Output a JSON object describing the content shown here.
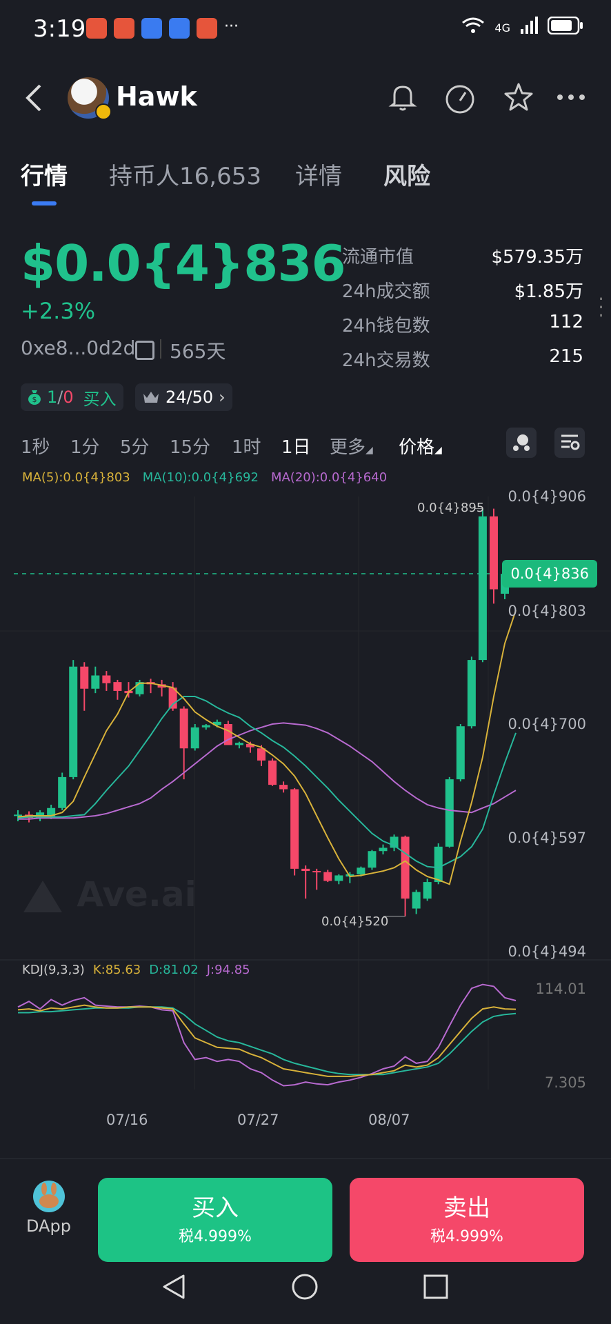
{
  "status_bar": {
    "time": "3:19",
    "more": "···",
    "network": "4G"
  },
  "header": {
    "title": "Hawk"
  },
  "tabs": [
    {
      "label": "行情"
    },
    {
      "label": "持币人16,653"
    },
    {
      "label": "详情"
    },
    {
      "label": "风险"
    }
  ],
  "price": {
    "value": "$0.0{4}836",
    "change": "+2.3%",
    "address": "0xe8...0d2d",
    "age": "565天"
  },
  "stats": [
    {
      "label": "流通市值",
      "value": "$579.35万"
    },
    {
      "label": "24h成交额",
      "value": "$1.85万"
    },
    {
      "label": "24h钱包数",
      "value": "112"
    },
    {
      "label": "24h交易数",
      "value": "215"
    }
  ],
  "badges": {
    "trades_buy": "1",
    "trades_sep": "/",
    "trades_sell": "0",
    "buy_label": "买入",
    "rank": "24/50"
  },
  "intervals": [
    "1秒",
    "1分",
    "5分",
    "15分",
    "1时",
    "1日",
    "更多",
    "价格"
  ],
  "active_interval": "1日",
  "ma_legend": {
    "ma5": "MA(5):0.0{4}803",
    "ma10": "MA(10):0.0{4}692",
    "ma20": "MA(20):0.0{4}640"
  },
  "watermark": "Ave.ai",
  "y_labels": [
    "0.0{4}906",
    "0.0{4}803",
    "0.0{4}700",
    "0.0{4}597",
    "0.0{4}494"
  ],
  "current_price_tag": "0.0{4}836",
  "annotations": {
    "high": "0.0{4}895",
    "low": "0.0{4}520"
  },
  "kdj_legend": {
    "name": "KDJ(9,3,3)",
    "k": "K:85.63",
    "d": "D:81.02",
    "j": "J:94.85",
    "max": "114.01",
    "min": "7.305"
  },
  "x_labels": [
    "07/16",
    "07/27",
    "08/07"
  ],
  "colors": {
    "up": "#20c18c",
    "down": "#f54869",
    "ma5": "#d8b23a",
    "ma10": "#27b79b",
    "ma20": "#b86ad0"
  },
  "chart_data": {
    "type": "candlestick",
    "x": [
      "07/16",
      "07/27",
      "08/07"
    ],
    "ylim": [
      4.94e-05,
      9.06e-05
    ],
    "candles": [
      {
        "o": 617,
        "h": 622,
        "l": 612,
        "c": 618
      },
      {
        "o": 618,
        "h": 621,
        "l": 611,
        "c": 615
      },
      {
        "o": 615,
        "h": 622,
        "l": 612,
        "c": 620
      },
      {
        "o": 616,
        "h": 627,
        "l": 614,
        "c": 624
      },
      {
        "o": 624,
        "h": 656,
        "l": 622,
        "c": 652
      },
      {
        "o": 652,
        "h": 758,
        "l": 650,
        "c": 752
      },
      {
        "o": 752,
        "h": 756,
        "l": 712,
        "c": 732
      },
      {
        "o": 732,
        "h": 752,
        "l": 728,
        "c": 744
      },
      {
        "o": 744,
        "h": 748,
        "l": 730,
        "c": 737
      },
      {
        "o": 738,
        "h": 740,
        "l": 722,
        "c": 730
      },
      {
        "o": 730,
        "h": 738,
        "l": 724,
        "c": 728
      },
      {
        "o": 727,
        "h": 740,
        "l": 725,
        "c": 738
      },
      {
        "o": 738,
        "h": 741,
        "l": 728,
        "c": 736
      },
      {
        "o": 736,
        "h": 740,
        "l": 725,
        "c": 733
      },
      {
        "o": 733,
        "h": 738,
        "l": 712,
        "c": 714
      },
      {
        "o": 714,
        "h": 716,
        "l": 650,
        "c": 678
      },
      {
        "o": 678,
        "h": 700,
        "l": 676,
        "c": 697
      },
      {
        "o": 697,
        "h": 700,
        "l": 695,
        "c": 699
      },
      {
        "o": 699,
        "h": 704,
        "l": 697,
        "c": 702
      },
      {
        "o": 700,
        "h": 703,
        "l": 690,
        "c": 681
      },
      {
        "o": 681,
        "h": 684,
        "l": 678,
        "c": 683
      },
      {
        "o": 682,
        "h": 684,
        "l": 674,
        "c": 679
      },
      {
        "o": 678,
        "h": 681,
        "l": 662,
        "c": 667
      },
      {
        "o": 667,
        "h": 669,
        "l": 644,
        "c": 645
      },
      {
        "o": 645,
        "h": 648,
        "l": 638,
        "c": 641
      },
      {
        "o": 641,
        "h": 642,
        "l": 563,
        "c": 569
      },
      {
        "o": 569,
        "h": 572,
        "l": 542,
        "c": 567
      },
      {
        "o": 567,
        "h": 569,
        "l": 550,
        "c": 566
      },
      {
        "o": 566,
        "h": 568,
        "l": 557,
        "c": 558
      },
      {
        "o": 558,
        "h": 564,
        "l": 555,
        "c": 563
      },
      {
        "o": 562,
        "h": 566,
        "l": 556,
        "c": 564
      },
      {
        "o": 564,
        "h": 571,
        "l": 562,
        "c": 570
      },
      {
        "o": 570,
        "h": 586,
        "l": 568,
        "c": 585
      },
      {
        "o": 585,
        "h": 591,
        "l": 582,
        "c": 588
      },
      {
        "o": 588,
        "h": 600,
        "l": 585,
        "c": 598
      },
      {
        "o": 598,
        "h": 599,
        "l": 526,
        "c": 542
      },
      {
        "o": 533,
        "h": 550,
        "l": 528,
        "c": 548
      },
      {
        "o": 542,
        "h": 560,
        "l": 540,
        "c": 557
      },
      {
        "o": 557,
        "h": 592,
        "l": 555,
        "c": 589
      },
      {
        "o": 589,
        "h": 652,
        "l": 588,
        "c": 650
      },
      {
        "o": 650,
        "h": 700,
        "l": 648,
        "c": 698
      },
      {
        "o": 698,
        "h": 761,
        "l": 696,
        "c": 758
      },
      {
        "o": 758,
        "h": 895,
        "l": 756,
        "c": 888
      },
      {
        "o": 888,
        "h": 895,
        "l": 809,
        "c": 822
      },
      {
        "o": 818,
        "h": 838,
        "l": 813,
        "c": 836
      }
    ],
    "ma5": [
      616,
      617,
      617,
      617,
      620,
      630,
      652,
      673,
      694,
      709,
      729,
      737,
      737,
      735,
      733,
      723,
      711,
      704,
      698,
      694,
      688,
      682,
      679,
      672,
      664,
      653,
      637,
      617,
      597,
      578,
      562,
      563,
      565,
      567,
      570,
      576,
      568,
      562,
      559,
      555,
      594,
      629,
      670,
      725,
      773,
      803
    ],
    "ma10": [
      615,
      616,
      616,
      616,
      616,
      617,
      618,
      628,
      640,
      651,
      662,
      676,
      690,
      705,
      718,
      725,
      725,
      721,
      715,
      710,
      706,
      698,
      692,
      685,
      679,
      671,
      662,
      652,
      642,
      631,
      621,
      611,
      601,
      594,
      590,
      583,
      576,
      571,
      570,
      575,
      580,
      589,
      605,
      636,
      665,
      692
    ],
    "ma20": [
      614,
      614,
      615,
      615,
      615,
      615,
      616,
      617,
      619,
      622,
      625,
      628,
      633,
      641,
      648,
      656,
      664,
      672,
      680,
      686,
      690,
      694,
      697,
      700,
      701,
      700,
      699,
      696,
      692,
      686,
      680,
      673,
      666,
      657,
      648,
      640,
      633,
      627,
      624,
      622,
      621,
      620,
      624,
      628,
      634,
      640
    ],
    "kdj": {
      "k": [
        85,
        86,
        84,
        87,
        86,
        88,
        90,
        88,
        87,
        87,
        88,
        88,
        88,
        87,
        86,
        70,
        55,
        50,
        45,
        44,
        43,
        38,
        34,
        28,
        22,
        20,
        18,
        16,
        14,
        14,
        14,
        15,
        16,
        18,
        20,
        26,
        24,
        26,
        34,
        48,
        62,
        76,
        86,
        88,
        86,
        85.63
      ],
      "d": [
        82,
        82,
        83,
        83,
        84,
        85,
        86,
        87,
        87,
        87,
        87,
        88,
        88,
        88,
        87,
        80,
        70,
        63,
        56,
        52,
        50,
        46,
        42,
        38,
        32,
        28,
        25,
        22,
        19,
        17,
        16,
        16,
        16,
        16,
        18,
        20,
        22,
        24,
        28,
        38,
        50,
        62,
        72,
        78,
        80,
        81.02
      ],
      "j": [
        88,
        94,
        86,
        96,
        90,
        95,
        98,
        90,
        89,
        88,
        88,
        89,
        88,
        85,
        84,
        50,
        32,
        34,
        30,
        32,
        30,
        22,
        18,
        10,
        4,
        5,
        8,
        6,
        5,
        8,
        10,
        13,
        17,
        22,
        25,
        35,
        28,
        30,
        45,
        68,
        90,
        108,
        112,
        110,
        98,
        94.85
      ]
    }
  },
  "bottom": {
    "dapp": "DApp",
    "buy": "买入",
    "buy_tax": "税4.999%",
    "sell": "卖出",
    "sell_tax": "税4.999%"
  }
}
